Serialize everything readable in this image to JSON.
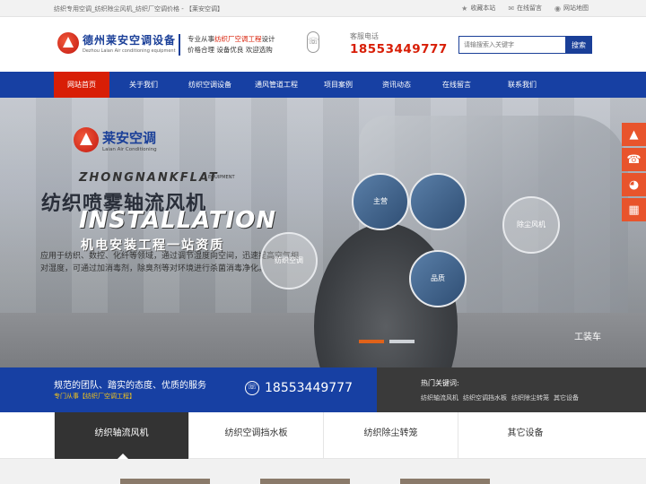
{
  "topbar": {
    "text": "纺织专用空调_纺织除尘风机_纺织厂空调价格 - 【莱安空调】",
    "links": [
      {
        "icon": "star-icon",
        "glyph": "★",
        "label": "收藏本站"
      },
      {
        "icon": "message-icon",
        "glyph": "✉",
        "label": "在线留言"
      },
      {
        "icon": "location-icon",
        "glyph": "◉",
        "label": "网站地图"
      }
    ]
  },
  "header": {
    "logo_name": "德州莱安空调设备",
    "logo_en": "Dezhou Laian Air conditioning equipment",
    "slogan_line1_pre": "专业从事",
    "slogan_line1_hl": "纺织厂空调工程",
    "slogan_line1_post": "设计",
    "slogan_line2": "价格合理  设备优良  欢迎选购",
    "hotline_label": "客服电话",
    "hotline_number": "18553449777",
    "search_placeholder": "请输搜索入关键字",
    "search_button": "搜索"
  },
  "nav": {
    "items": [
      {
        "label": "网站首页",
        "active": true
      },
      {
        "label": "关于我们",
        "active": false
      },
      {
        "label": "纺织空调设备",
        "active": false
      },
      {
        "label": "通风管道工程",
        "active": false
      },
      {
        "label": "项目案例",
        "active": false
      },
      {
        "label": "资讯动态",
        "active": false
      },
      {
        "label": "在线留言",
        "active": false
      },
      {
        "label": "联系我们",
        "active": false
      }
    ]
  },
  "banner": {
    "logo_name": "莱安空调",
    "logo_en": "Laian Air Conditioning",
    "zhong": "ZHONGNANKFLAT",
    "equip": "EQUIPMENT",
    "headline": "纺织喷雾轴流风机",
    "install": "INSTALLATION",
    "install_sub": "机电安装工程一站资质",
    "desc": "应用于纺织、数控、化纤等领域，通过调节湿度向空间，迅速提高空气相对湿度，可通过加消毒剂，除臭剂等对环境进行杀菌消毒净化。",
    "hex_labels": [
      "主营",
      "除尘风机",
      "纺织空调",
      "品质"
    ],
    "sign": "工装车"
  },
  "float": {
    "items": [
      {
        "icon": "top-icon",
        "glyph": "▲"
      },
      {
        "icon": "phone-icon",
        "glyph": "☎"
      },
      {
        "icon": "qq-icon",
        "glyph": "◕"
      },
      {
        "icon": "qrcode-icon",
        "glyph": "▦"
      }
    ]
  },
  "strip": {
    "title": "规范的团队、踏实的态度、优质的服务",
    "sub": "专门从事【纺织厂空调工程】",
    "phone": "18553449777",
    "kw_title": "热门关键词:",
    "keywords": [
      "纺织轴流风机",
      "纺织空调挡水板",
      "纺织除尘转笼",
      "其它设备"
    ]
  },
  "tabs": {
    "items": [
      {
        "label": "纺织轴流风机",
        "active": true
      },
      {
        "label": "纺织空调挡水板",
        "active": false
      },
      {
        "label": "纺织除尘转笼",
        "active": false
      },
      {
        "label": "其它设备",
        "active": false
      }
    ]
  },
  "colors": {
    "brand_blue": "#1740a3",
    "accent_red": "#d81e06",
    "accent_orange": "#e8542c"
  }
}
